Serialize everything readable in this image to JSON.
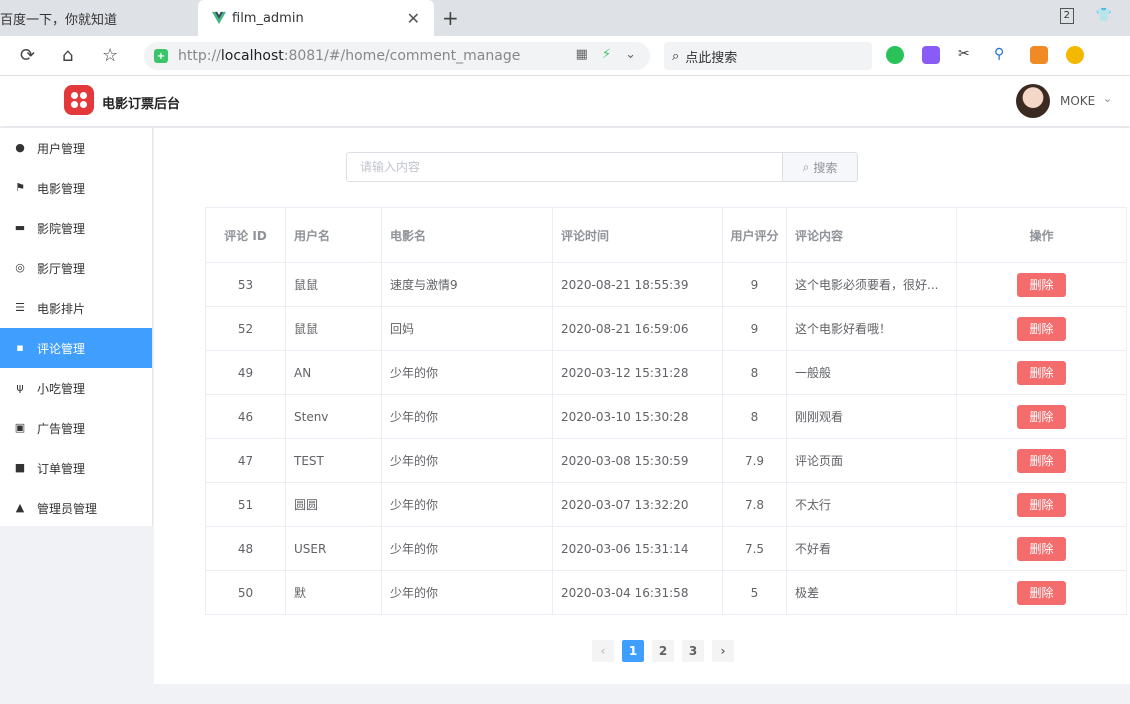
{
  "browser": {
    "tab_inactive": "百度一下，你就知道",
    "tab_active": "film_admin",
    "tab_count": "2",
    "url_scheme": "http://",
    "url_host": "localhost",
    "url_rest": ":8081/#/home/comment_manage",
    "search_placeholder": "点此搜索"
  },
  "header": {
    "title": "电影订票后台",
    "username": "MOKE"
  },
  "sidebar": {
    "items": [
      {
        "label": "用户管理",
        "icon": "user-icon"
      },
      {
        "label": "电影管理",
        "icon": "flag-icon"
      },
      {
        "label": "影院管理",
        "icon": "cinema-icon"
      },
      {
        "label": "影厅管理",
        "icon": "hall-icon"
      },
      {
        "label": "电影排片",
        "icon": "list-icon"
      },
      {
        "label": "评论管理",
        "icon": "comment-icon"
      },
      {
        "label": "小吃管理",
        "icon": "fork-icon"
      },
      {
        "label": "广告管理",
        "icon": "ad-icon"
      },
      {
        "label": "订单管理",
        "icon": "order-icon"
      },
      {
        "label": "管理员管理",
        "icon": "admin-icon"
      }
    ],
    "active_index": 5
  },
  "search": {
    "placeholder": "请输入内容",
    "button_label": "搜索"
  },
  "table": {
    "columns": [
      "评论 ID",
      "用户名",
      "电影名",
      "评论时间",
      "用户评分",
      "评论内容",
      "操作"
    ],
    "rows": [
      {
        "id": "53",
        "user": "鼠鼠",
        "film": "速度与激情9",
        "time": "2020-08-21 18:55:39",
        "score": "9",
        "content": "这个电影必须要看，很好..."
      },
      {
        "id": "52",
        "user": "鼠鼠",
        "film": "回妈",
        "time": "2020-08-21 16:59:06",
        "score": "9",
        "content": "这个电影好看哦！"
      },
      {
        "id": "49",
        "user": "AN",
        "film": "少年的你",
        "time": "2020-03-12 15:31:28",
        "score": "8",
        "content": "一般般"
      },
      {
        "id": "46",
        "user": "Stenv",
        "film": "少年的你",
        "time": "2020-03-10 15:30:28",
        "score": "8",
        "content": "刚刚观看"
      },
      {
        "id": "47",
        "user": "TEST",
        "film": "少年的你",
        "time": "2020-03-08 15:30:59",
        "score": "7.9",
        "content": "评论页面"
      },
      {
        "id": "51",
        "user": "圆圆",
        "film": "少年的你",
        "time": "2020-03-07 13:32:20",
        "score": "7.8",
        "content": "不太行"
      },
      {
        "id": "48",
        "user": "USER",
        "film": "少年的你",
        "time": "2020-03-06 15:31:14",
        "score": "7.5",
        "content": "不好看"
      },
      {
        "id": "50",
        "user": "默",
        "film": "少年的你",
        "time": "2020-03-04 16:31:58",
        "score": "5",
        "content": "极差"
      }
    ],
    "delete_label": "删除"
  },
  "pagination": {
    "pages": [
      "1",
      "2",
      "3"
    ],
    "current": "1",
    "prev": "‹",
    "next": "›"
  },
  "colors": {
    "primary": "#409eff",
    "danger": "#f56c6c",
    "logo": "#e4393c"
  }
}
